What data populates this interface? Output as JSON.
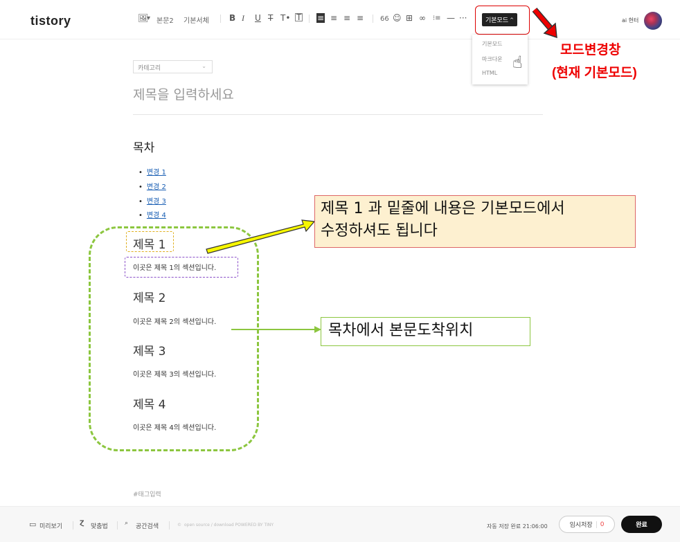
{
  "topbar": {
    "logo": "tistory",
    "image_icon": "image-icon",
    "style_select": "본문2",
    "font_select": "기본서체",
    "tools": [
      "B",
      "I",
      "U",
      "T",
      "T•",
      "T"
    ],
    "align_tools": [
      "≡",
      "≡",
      "≡",
      "≡"
    ],
    "insert_tools": [
      "66",
      "☺",
      "⊞",
      "∞",
      "⁝≡",
      "—",
      "···"
    ],
    "mode_button": "기본모드",
    "mode_caret": "^",
    "mode_options": [
      "기본모드",
      "마크다운",
      "HTML"
    ],
    "username": "ai 헌터"
  },
  "annotations": {
    "mode_label_line1": "모드변경창",
    "mode_label_line2": "(현재 기본모드)",
    "note_heading_line1": "제목 1 과 밑줄에 내용은 기본모드에서",
    "note_heading_line2": "수정하셔도 됩니다",
    "note_toc": "목차에서 본문도착위치"
  },
  "editor": {
    "category": "카테고리",
    "title_placeholder": "제목을 입력하세요",
    "toc_title": "목차",
    "toc_bullet": "•",
    "toc_items": [
      "변경 1",
      "변경 2",
      "변경 3",
      "변경 4"
    ],
    "sections": [
      {
        "heading": "제목 1",
        "body": "이곳은 제목 1의 섹션입니다."
      },
      {
        "heading": "제목 2",
        "body": "이곳은 제목 2의 섹션입니다."
      },
      {
        "heading": "제목 3",
        "body": "이곳은 제목 3의 섹션입니다."
      },
      {
        "heading": "제목 4",
        "body": "이곳은 제목 4의 섹션입니다."
      }
    ],
    "tag_placeholder": "#태그입력"
  },
  "bottombar": {
    "preview": "미리보기",
    "spellcheck": "맞춤법",
    "space_search": "공간검색",
    "powered": "open source / download     POWERED BY TINY",
    "autosave": "자동 저장 완료 21:06:00",
    "temp_save": "임시저장",
    "temp_count": "0",
    "publish": "완료"
  },
  "colors": {
    "accent_red": "#ee0000",
    "green": "#8cc63f",
    "link": "#1a5fb4"
  }
}
